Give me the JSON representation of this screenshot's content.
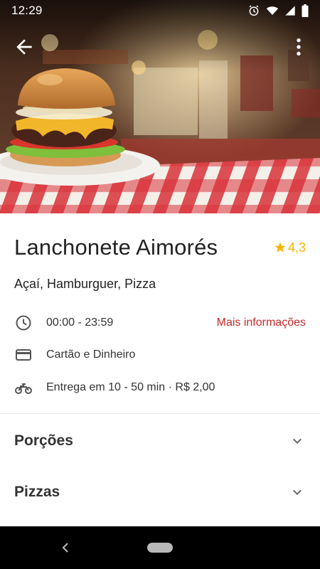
{
  "status_bar": {
    "time": "12:29",
    "icons": [
      "alarm-icon",
      "wifi-icon",
      "signal-icon",
      "battery-icon"
    ]
  },
  "app_bar": {
    "back_icon": "arrow-back-icon",
    "menu_icon": "more-vert-icon"
  },
  "restaurant": {
    "name": "Lanchonete Aimorés",
    "rating": "4,3",
    "rating_color": "#f5b400",
    "cuisines": "Açaí, Hamburguer, Pizza",
    "hours": "00:00 - 23:59",
    "more_info_label": "Mais informações",
    "accent_color": "#c62828",
    "payment": "Cartão e Dinheiro",
    "delivery": "Entrega em 10 - 50 min · R$ 2,00"
  },
  "menu_categories": [
    {
      "label": "Porções"
    },
    {
      "label": "Pizzas"
    }
  ],
  "nav_bar": {
    "icons": [
      "nav-back-icon",
      "nav-home-pill"
    ]
  }
}
